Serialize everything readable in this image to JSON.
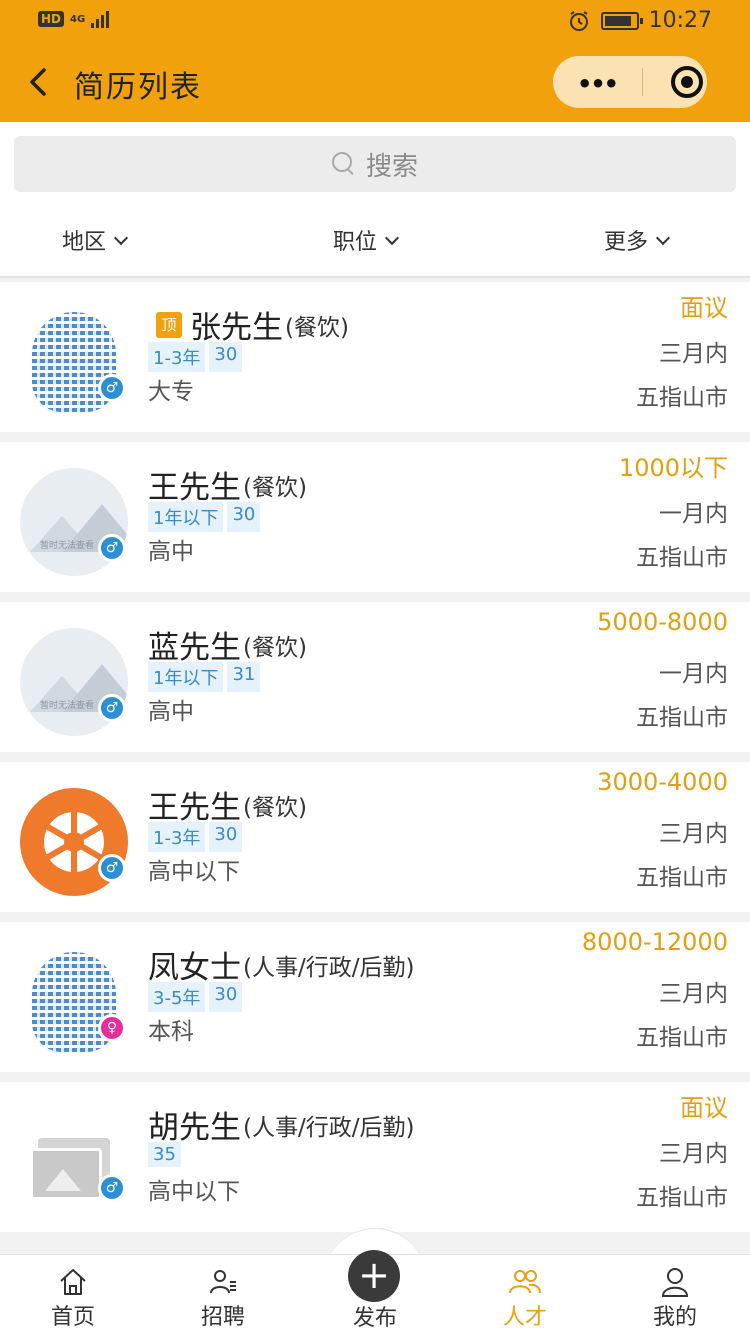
{
  "status_bar": {
    "network": "4G",
    "hd": "HD",
    "time": "10:27"
  },
  "nav": {
    "title": "简历列表",
    "back_icon": "chevron-left-icon",
    "more_icon": "more-dots-icon",
    "close_icon": "target-icon"
  },
  "search": {
    "placeholder": "搜索"
  },
  "filters": [
    {
      "label": "地区"
    },
    {
      "label": "职位"
    },
    {
      "label": "更多"
    }
  ],
  "resumes": [
    {
      "top_badge": "顶",
      "name": "张先生",
      "position": "(餐饮)",
      "tags": [
        "1-3年",
        "30"
      ],
      "education": "大专",
      "salary": "面议",
      "time": "三月内",
      "city": "五指山市",
      "gender": "male",
      "avatar": "qr-code"
    },
    {
      "top_badge": "",
      "name": "王先生",
      "position": "(餐饮)",
      "tags": [
        "1年以下",
        "30"
      ],
      "education": "高中",
      "salary": "1000以下",
      "time": "一月内",
      "city": "五指山市",
      "gender": "male",
      "avatar": "placeholder",
      "avatar_caption": "暂时无法查看"
    },
    {
      "top_badge": "",
      "name": "蓝先生",
      "position": "(餐饮)",
      "tags": [
        "1年以下",
        "31"
      ],
      "education": "高中",
      "salary": "5000-8000",
      "time": "一月内",
      "city": "五指山市",
      "gender": "male",
      "avatar": "placeholder",
      "avatar_caption": "暂时无法查看"
    },
    {
      "top_badge": "",
      "name": "王先生",
      "position": "(餐饮)",
      "tags": [
        "1-3年",
        "30"
      ],
      "education": "高中以下",
      "salary": "3000-4000",
      "time": "三月内",
      "city": "五指山市",
      "gender": "male",
      "avatar": "wheel"
    },
    {
      "top_badge": "",
      "name": "凤女士",
      "position": "(人事/行政/后勤)",
      "tags": [
        "3-5年",
        "30"
      ],
      "education": "本科",
      "salary": "8000-12000",
      "time": "三月内",
      "city": "五指山市",
      "gender": "female",
      "avatar": "qr-code"
    },
    {
      "top_badge": "",
      "name": "胡先生",
      "position": "(人事/行政/后勤)",
      "tags": [
        "35"
      ],
      "education": "高中以下",
      "salary": "面议",
      "time": "三月内",
      "city": "五指山市",
      "gender": "male",
      "avatar": "image-placeholder"
    }
  ],
  "tabbar": {
    "home": "首页",
    "recruit": "招聘",
    "publish": "发布",
    "talent": "人才",
    "mine": "我的",
    "active": "talent"
  },
  "colors": {
    "brand": "#f0a10b",
    "salary": "#e0a012",
    "tag_bg": "#e6f2fb",
    "tag_text": "#3b8bc6"
  }
}
